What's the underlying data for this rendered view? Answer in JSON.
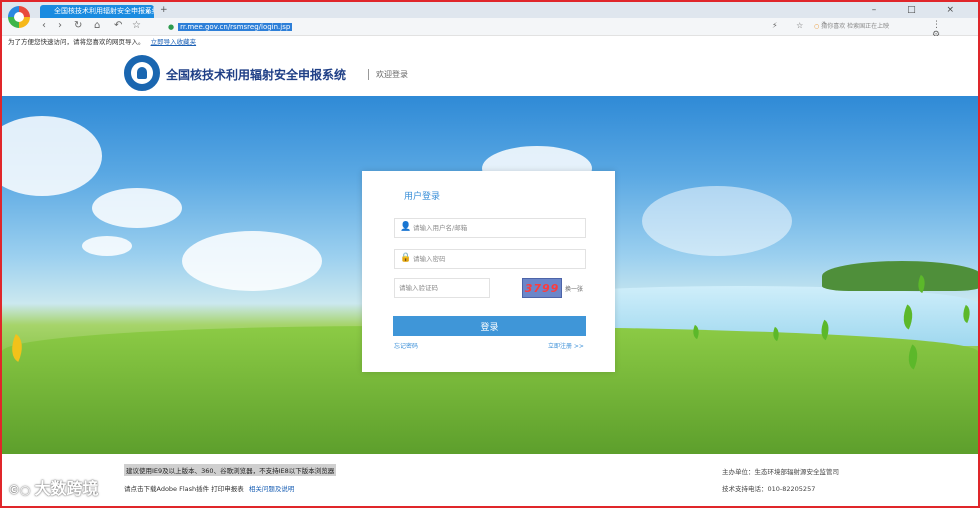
{
  "browser": {
    "tab_title": "全国核技术利用辐射安全申报系统",
    "tab_close": "×",
    "new_tab": "+",
    "url": "rr.mee.gov.cn/rsmsreg/login.jsp",
    "secure_icon": "lock-icon",
    "search_placeholder": "猜你喜欢 检索国正在上映",
    "win_controls": "– □ ×",
    "addr_tools": "⚡ ☆ ˅",
    "right_tools": "⋮ ⚙ ≡"
  },
  "bookmarks": {
    "text": "为了方便您快速访问，请将您喜欢的网页导入。",
    "link": "立即导入收藏夹"
  },
  "site": {
    "title": "全国核技术利用辐射安全申报系统",
    "subtitle": "欢迎登录"
  },
  "login": {
    "title": "用户登录",
    "username_placeholder": "请输入用户名/邮箱",
    "password_placeholder": "请输入密码",
    "captcha_placeholder": "请输入验证码",
    "captcha_value": "3799",
    "refresh_label": "换一张",
    "login_button": "登录",
    "forgot_link": "忘记密码",
    "register_link": "立即注册 >>"
  },
  "footer": {
    "note": "建议使用IE9及以上版本、360、谷歌浏览器，不支持IE8以下版本浏览器",
    "line2_text": "请点击下载Adobe Flash插件 打印申报表",
    "line2_link": "相关问题及说明",
    "right1": "主办单位：生态环境部辐射源安全监管司",
    "right2": "技术支持电话：010-82205257"
  },
  "watermark": {
    "mark": "©○",
    "text": "大数跨境"
  },
  "colors": {
    "frame": "#e0262a",
    "accent": "#3f96d8",
    "title": "#1f3f86"
  }
}
